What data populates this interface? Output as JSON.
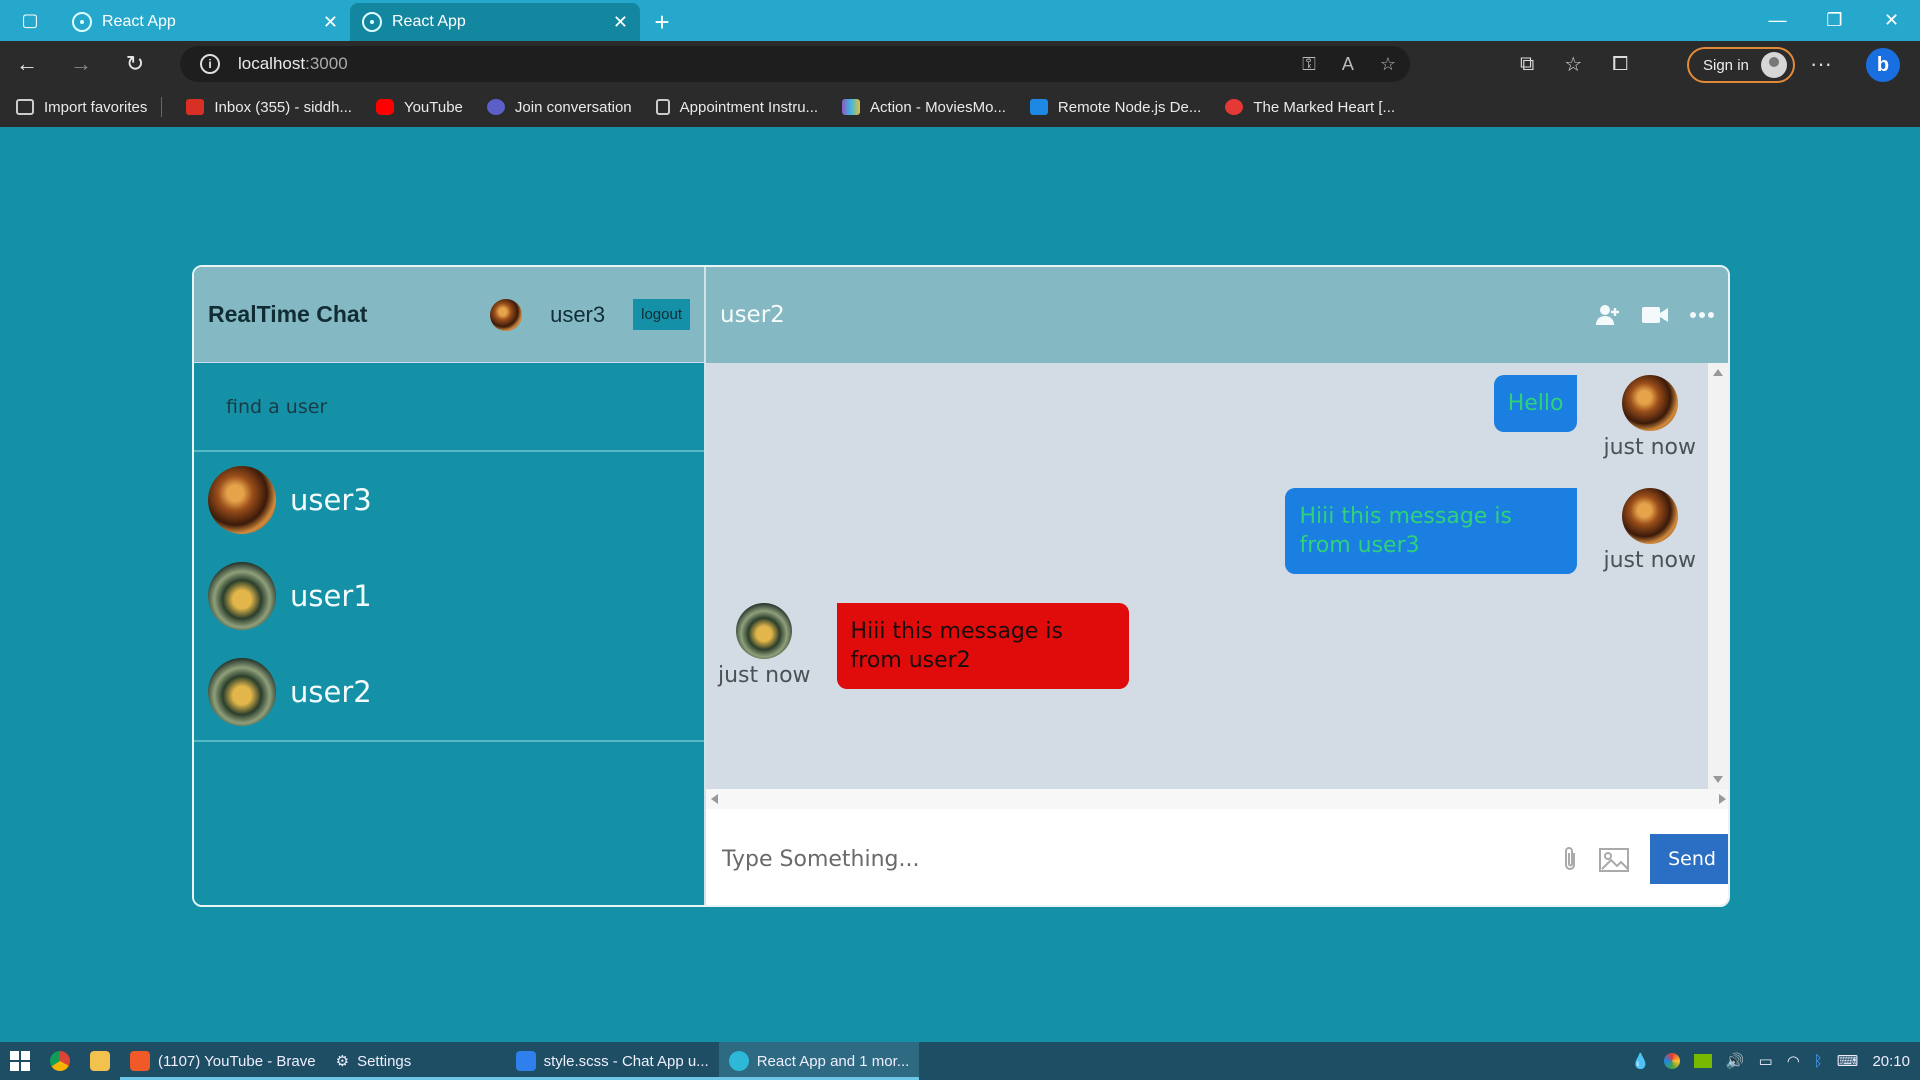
{
  "browser": {
    "tabs": [
      {
        "title": "React App",
        "active": false
      },
      {
        "title": "React App",
        "active": true
      }
    ],
    "url_host": "localhost",
    "url_port": ":3000",
    "sign_in": "Sign in",
    "favorites": [
      {
        "label": "Import favorites",
        "icon": "import-icon",
        "color": "#cccccc"
      },
      {
        "label": "Inbox (355) - siddh...",
        "icon": "gmail-icon",
        "color": "#d93025"
      },
      {
        "label": "YouTube",
        "icon": "youtube-icon",
        "color": "#ff0000"
      },
      {
        "label": "Join conversation",
        "icon": "teams-icon",
        "color": "#5b5fc7"
      },
      {
        "label": "Appointment Instru...",
        "icon": "document-icon",
        "color": "#cccccc"
      },
      {
        "label": "Action - MoviesMo...",
        "icon": "movies-icon",
        "color": "#8a5cc0"
      },
      {
        "label": "Remote Node.js De...",
        "icon": "rs-icon",
        "color": "#1e88e5"
      },
      {
        "label": "The Marked Heart [...",
        "icon": "heart-icon",
        "color": "#e53935"
      }
    ]
  },
  "app": {
    "brand": "RealTime Chat",
    "current_user": "user3",
    "logout": "logout",
    "search_placeholder": "find a user",
    "users": [
      {
        "name": "user3",
        "avatar": "warm"
      },
      {
        "name": "user1",
        "avatar": "cool"
      },
      {
        "name": "user2",
        "avatar": "cool"
      }
    ],
    "chat_with": "user2",
    "messages": [
      {
        "text": "Hello",
        "time": "just now",
        "owner": true
      },
      {
        "text": "Hiii this message is from user3",
        "time": "just now",
        "owner": true
      },
      {
        "text": "Hiii this message is from user2",
        "time": "just now",
        "owner": false
      }
    ],
    "input_placeholder": "Type Something...",
    "send": "Send"
  },
  "taskbar": {
    "items": [
      {
        "label": "(1107) YouTube - Brave",
        "icon": "brave-icon",
        "color": "#f05a28"
      },
      {
        "label": "Settings",
        "icon": "gear-icon",
        "color": "#cccccc"
      },
      {
        "label": "style.scss - Chat App u...",
        "icon": "vscode-icon",
        "color": "#2f80ed"
      },
      {
        "label": "React App and 1 mor...",
        "icon": "edge-icon",
        "color": "#2cb8d6"
      }
    ],
    "clock": "20:10"
  }
}
